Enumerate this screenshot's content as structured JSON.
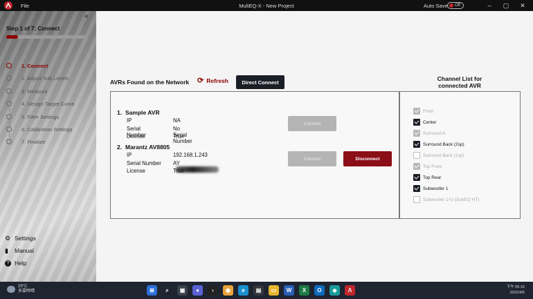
{
  "titlebar": {
    "file_menu": "File",
    "window_title": "MultEQ-X - New Project",
    "autosave_label": "Auto Save",
    "autosave_state": "Off",
    "accent": "#c0282d"
  },
  "sidebar": {
    "collapse_glyph": "«",
    "step_title": "Step 1 of 7: Connect",
    "progress": 0.15,
    "steps": [
      {
        "label": "1. Connect",
        "active": true
      },
      {
        "label": "2. Adjust Sub Levels",
        "active": false
      },
      {
        "label": "3. Measure",
        "active": false
      },
      {
        "label": "4. Design Target Curve",
        "active": false
      },
      {
        "label": "5. Filter Settings",
        "active": false
      },
      {
        "label": "6. Calibration Settings",
        "active": false
      },
      {
        "label": "7. Finalize",
        "active": false
      }
    ],
    "links": [
      {
        "label": "Settings",
        "icon": "gear-icon"
      },
      {
        "label": "Manual",
        "icon": "book-icon"
      },
      {
        "label": "Help",
        "icon": "question-icon"
      }
    ]
  },
  "main": {
    "avr_header": "AVRs Found on the Network",
    "refresh_label": "Refresh",
    "direct_connect_label": "Direct Connect",
    "devices": [
      {
        "index": "1.",
        "name": "Sample AVR",
        "fields": [
          {
            "key": "IP",
            "value": "NA"
          },
          {
            "key": "Serial Number",
            "value": "No Serial Number"
          },
          {
            "key": "License",
            "value": "True"
          }
        ],
        "connect_label": "Connect"
      },
      {
        "index": "2.",
        "name": "Marantz AV8805",
        "fields": [
          {
            "key": "IP",
            "value": "192.168.1.243"
          },
          {
            "key": "Serial Number",
            "value": "AY"
          },
          {
            "key": "License",
            "value": "True"
          }
        ],
        "connect_label": "Connect",
        "disconnect_label": "Disconnect"
      }
    ],
    "channel_list_title": "Channel List for connected AVR",
    "channels": [
      {
        "label": "Front",
        "checked": true,
        "enabled": false
      },
      {
        "label": "Center",
        "checked": true,
        "enabled": true
      },
      {
        "label": "Surround A",
        "checked": true,
        "enabled": false
      },
      {
        "label": "Surround Back (2sp)",
        "checked": true,
        "enabled": true
      },
      {
        "label": "Surround Back (1sp)",
        "checked": false,
        "enabled": false
      },
      {
        "label": "Top Front",
        "checked": true,
        "enabled": false
      },
      {
        "label": "Top Rear",
        "checked": true,
        "enabled": true
      },
      {
        "label": "Subwoofer 1",
        "checked": true,
        "enabled": true
      },
      {
        "label": "Subwoofer 1+2 (SubEQ HT)",
        "checked": false,
        "enabled": false
      }
    ],
    "primary_dark": "#1b1e26",
    "danger": "#8b0f17"
  },
  "taskbar": {
    "weather_temp": "29°C",
    "weather_desc": "多雲時晴",
    "time": "下午 05:15",
    "date": "2022/4/5"
  }
}
